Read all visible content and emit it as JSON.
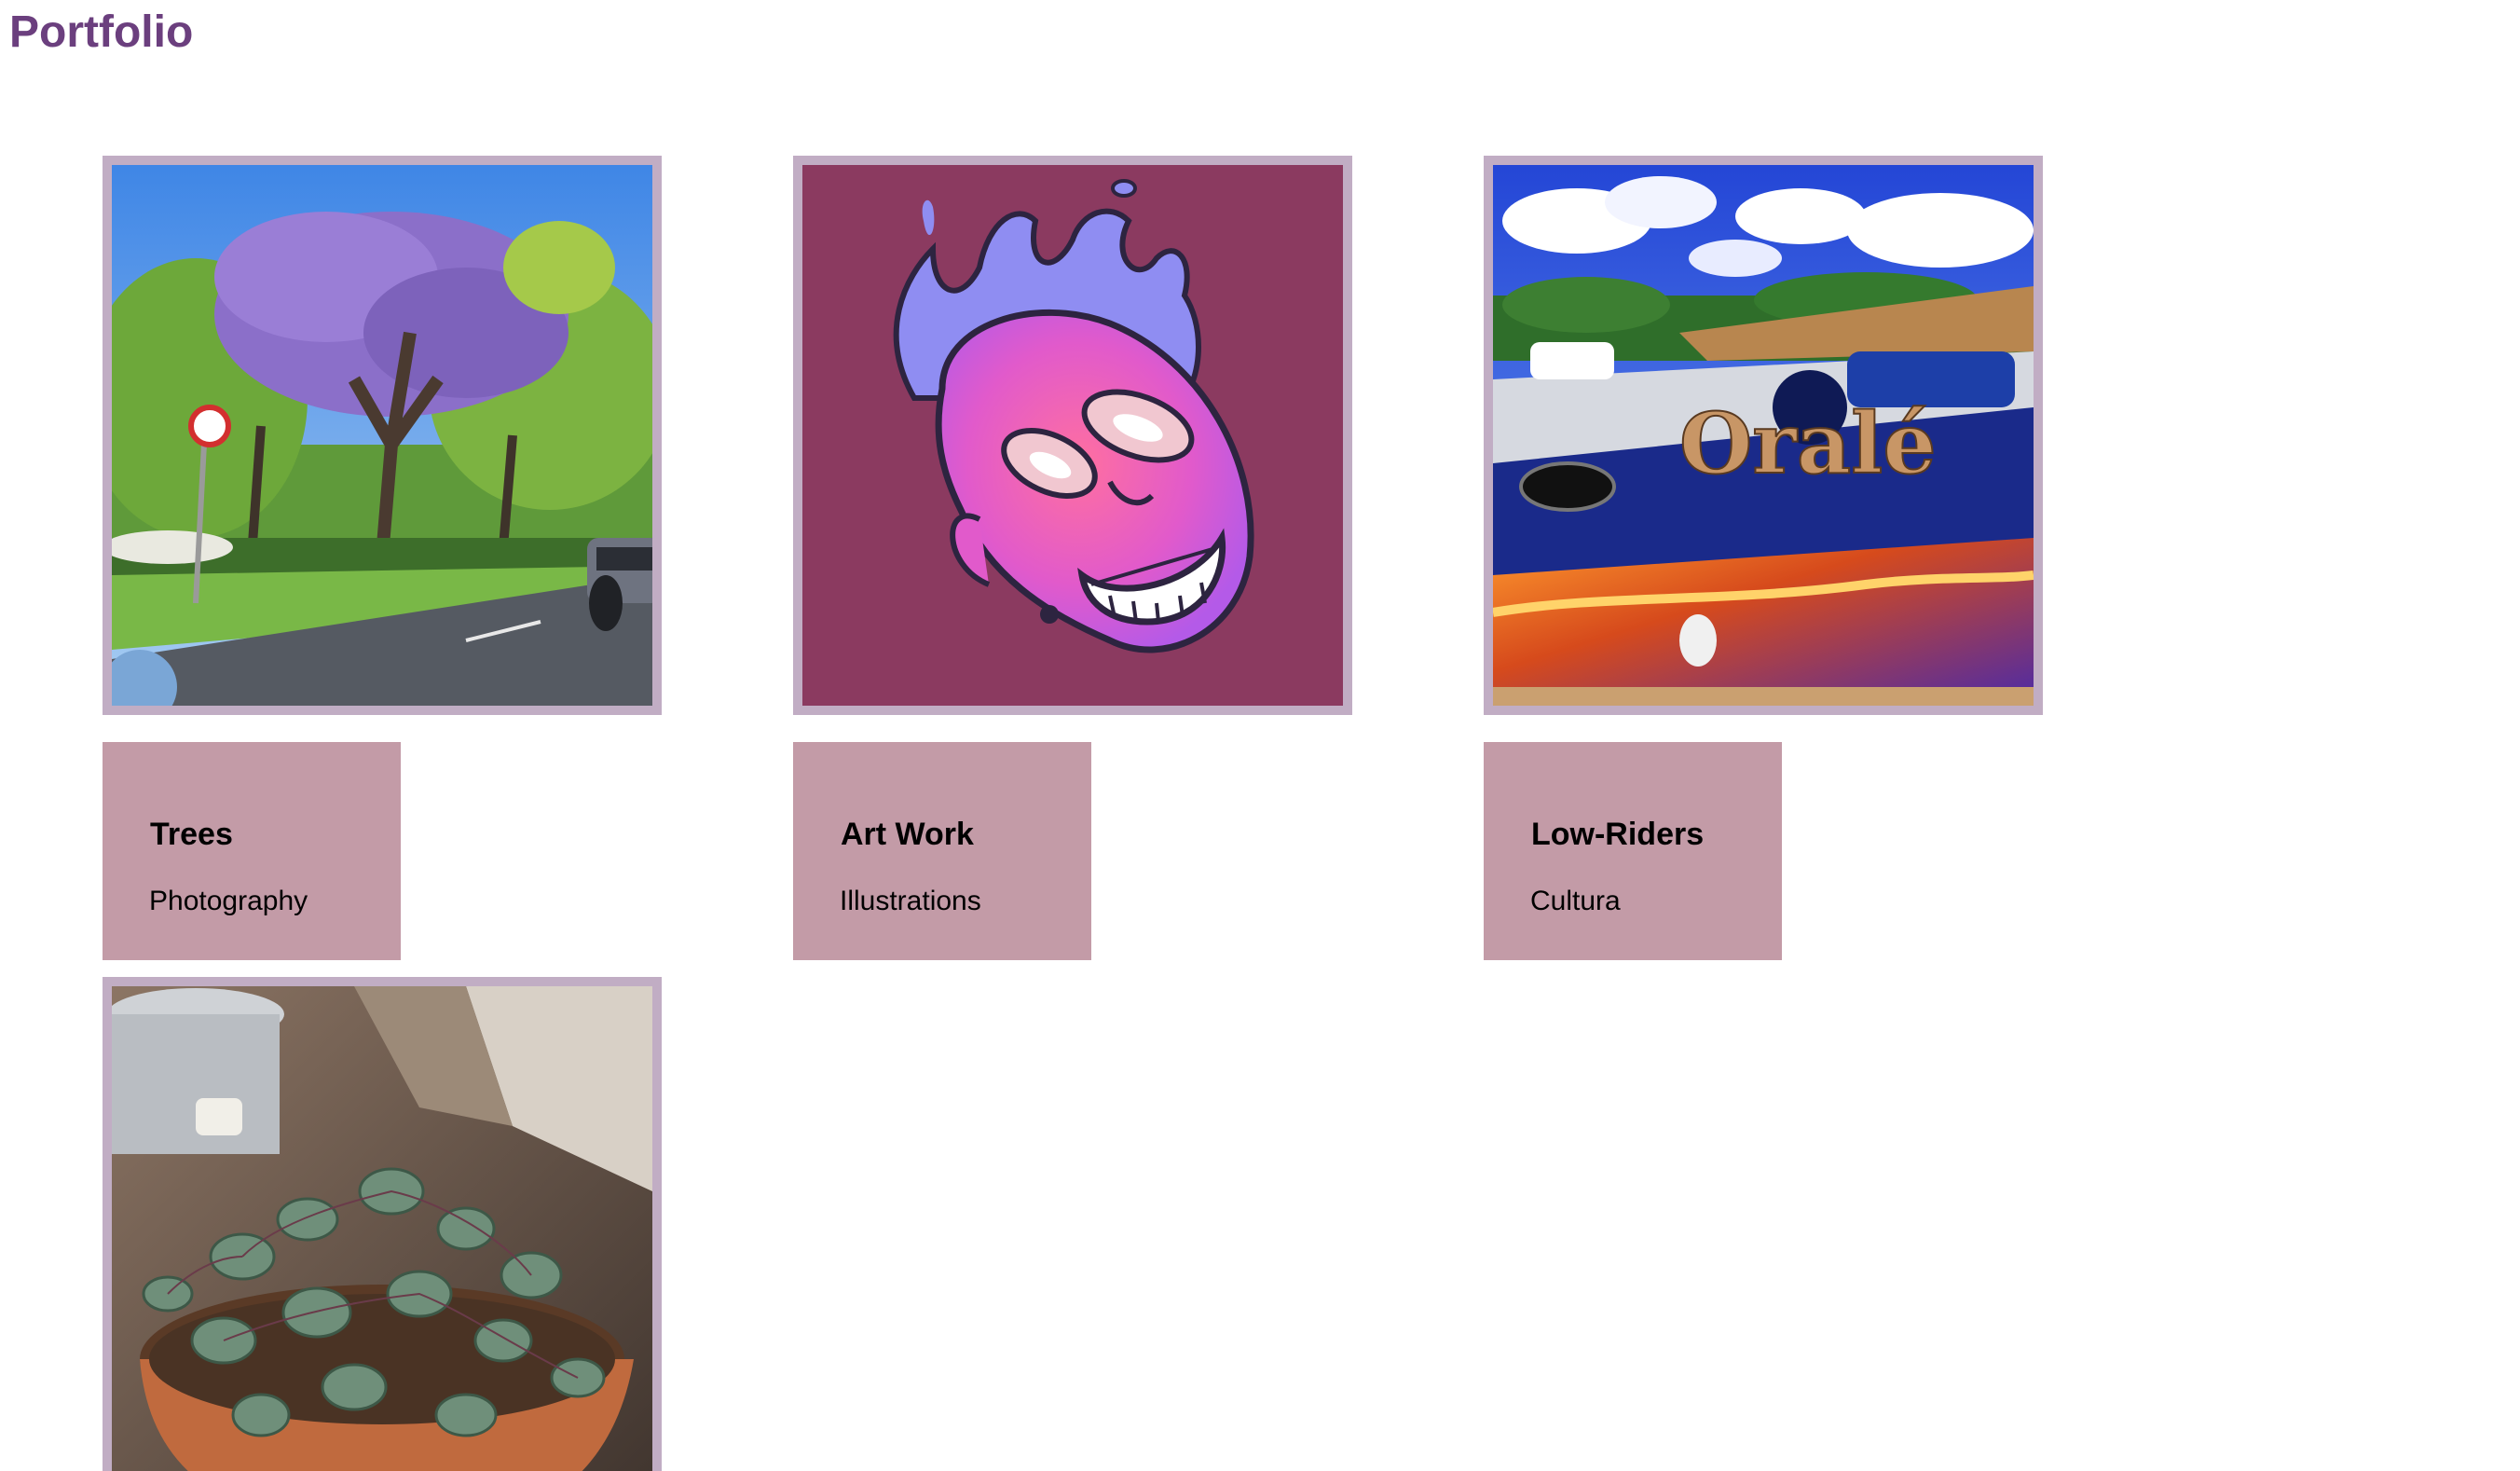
{
  "header": {
    "title": "Portfolio"
  },
  "gallery": {
    "items": [
      {
        "title": "Trees",
        "category": "Photography",
        "image_alt": "trees-photo"
      },
      {
        "title": "Art Work",
        "category": "Illustrations",
        "image_alt": "artwork-illustration"
      },
      {
        "title": "Low-Riders",
        "category": "Cultura",
        "image_alt": "lowrider-photo"
      },
      {
        "title": "",
        "category": "",
        "image_alt": "plant-photo"
      }
    ]
  },
  "colors": {
    "title": "#6b3f7e",
    "frame_border": "#c1adc4",
    "caption_bg": "#c39ba7",
    "artwork_bg": "#8b3a60"
  }
}
